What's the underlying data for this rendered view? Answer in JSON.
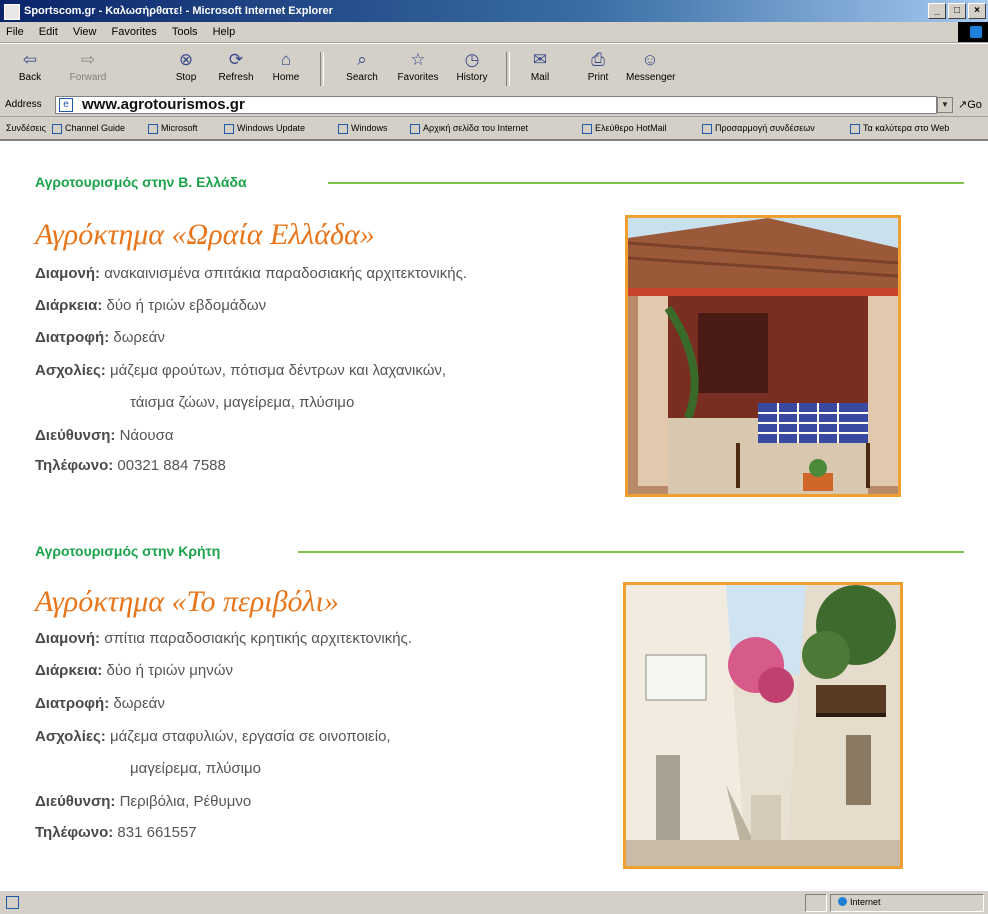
{
  "window": {
    "title": "Sportscom.gr - Καλωσήρθατε! - Microsoft Internet Explorer"
  },
  "menu": [
    "File",
    "Edit",
    "View",
    "Favorites",
    "Tools",
    "Help"
  ],
  "toolbar": {
    "back": "Back",
    "forward": "Forward",
    "stop": "Stop",
    "refresh": "Refresh",
    "home": "Home",
    "search": "Search",
    "favorites": "Favorites",
    "history": "History",
    "mail": "Mail",
    "print": "Print",
    "messenger": "Messenger"
  },
  "address": {
    "label": "Address",
    "url": "www.agrotourismos.gr",
    "go": "Go"
  },
  "links": {
    "label": "Συνδέσεις",
    "items": [
      "Channel Guide",
      "Microsoft",
      "Windows Update",
      "Windows",
      "Αρχική σελίδα του Internet",
      "Ελεύθερο HotMail",
      "Προσαρμογή συνδέσεων",
      "Τα καλύτερα στο Web"
    ]
  },
  "sections": [
    {
      "header": "Αγροτουρισμός στην Β. Ελλάδα",
      "title": "Αγρόκτημα «Ωραία Ελλάδα»",
      "stay_label": "Διαμονή:",
      "stay": "ανακαινισμένα σπιτάκια παραδοσιακής αρχιτεκτονικής.",
      "duration_label": "Διάρκεια:",
      "duration": "δύο ή τριών εβδομάδων",
      "food_label": "Διατροφή:",
      "food": "δωρεάν",
      "activities_label": "Ασχολίες:",
      "activities_1": "μάζεμα φρούτων, πότισμα δέντρων και λαχανικών,",
      "activities_2": "τάισμα ζώων, μαγείρεμα, πλύσιμο",
      "address_label": "Διεύθυνση:",
      "address": "Νάουσα",
      "phone_label": "Τηλέφωνο:",
      "phone": "00321  884 7588"
    },
    {
      "header": "Αγροτουρισμός στην Κρήτη",
      "title": "Αγρόκτημα  «Το περιβόλι»",
      "stay_label": "Διαμονή:",
      "stay": "σπίτια παραδοσιακής κρητικής αρχιτεκτονικής.",
      "duration_label": "Διάρκεια:",
      "duration": "δύο ή τριών μηνών",
      "food_label": "Διατροφή:",
      "food": "δωρεάν",
      "activities_label": "Ασχολίες:",
      "activities_1": "μάζεμα σταφυλιών, εργασία σε οινοποιείο,",
      "activities_2": "μαγείρεμα, πλύσιμο",
      "address_label": "Διεύθυνση:",
      "address": "Περιβόλια, Ρέθυμνο",
      "phone_label": "Τηλέφωνο:",
      "phone": "831 661557"
    }
  ],
  "status": {
    "zone": "Internet"
  },
  "colors": {
    "section_header": "#1aa34a",
    "section_line": "#7dc24b",
    "farm_title": "#e8751a",
    "photo_border": "#f0a030"
  }
}
